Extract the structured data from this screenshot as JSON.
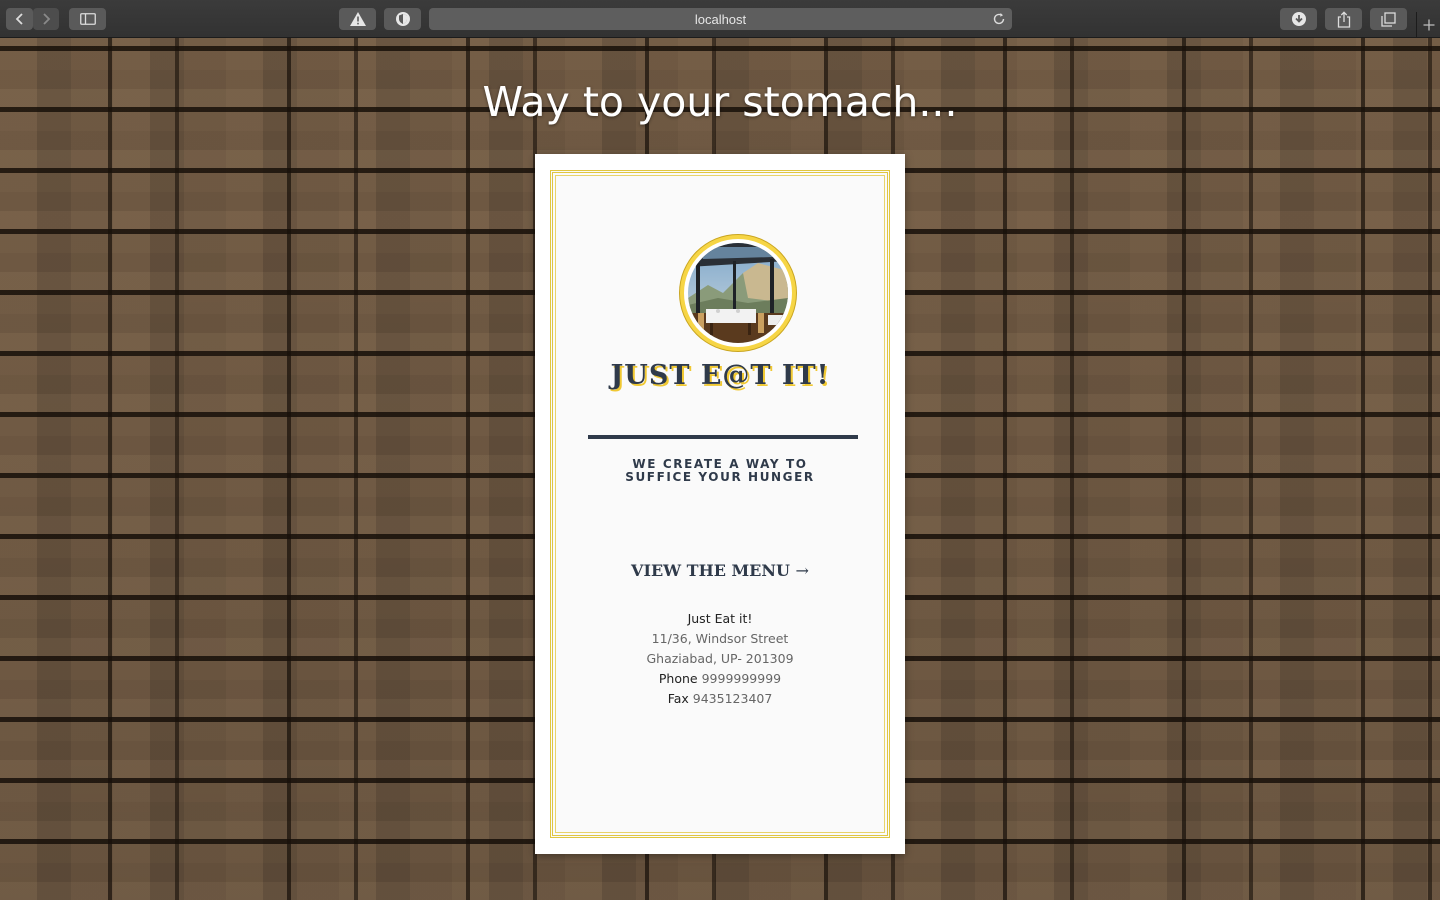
{
  "browser": {
    "url": "localhost",
    "icons": [
      "back-icon",
      "forward-icon",
      "sidebar-icon",
      "warning-icon",
      "privacy-shield-icon",
      "reload-icon",
      "download-icon",
      "share-icon",
      "tabs-icon",
      "new-tab-icon"
    ]
  },
  "page": {
    "headline": "Way to your stomach..."
  },
  "card": {
    "brand": "JUST E@T IT!",
    "tagline_line1": "WE CREATE A WAY TO",
    "tagline_line2": "SUFFICE YOUR HUNGER",
    "menu_label": "VIEW THE MENU",
    "menu_arrow": "→",
    "address": {
      "name": "Just Eat it!",
      "street": "11/36, Windsor Street",
      "city": "Ghaziabad, UP- 201309",
      "phone_label": "Phone",
      "phone": "9999999999",
      "fax_label": "Fax",
      "fax": "9435123407"
    }
  },
  "colors": {
    "accent_gold": "#e0c640",
    "navy": "#2f3a4a",
    "card_bg": "#ffffff"
  }
}
